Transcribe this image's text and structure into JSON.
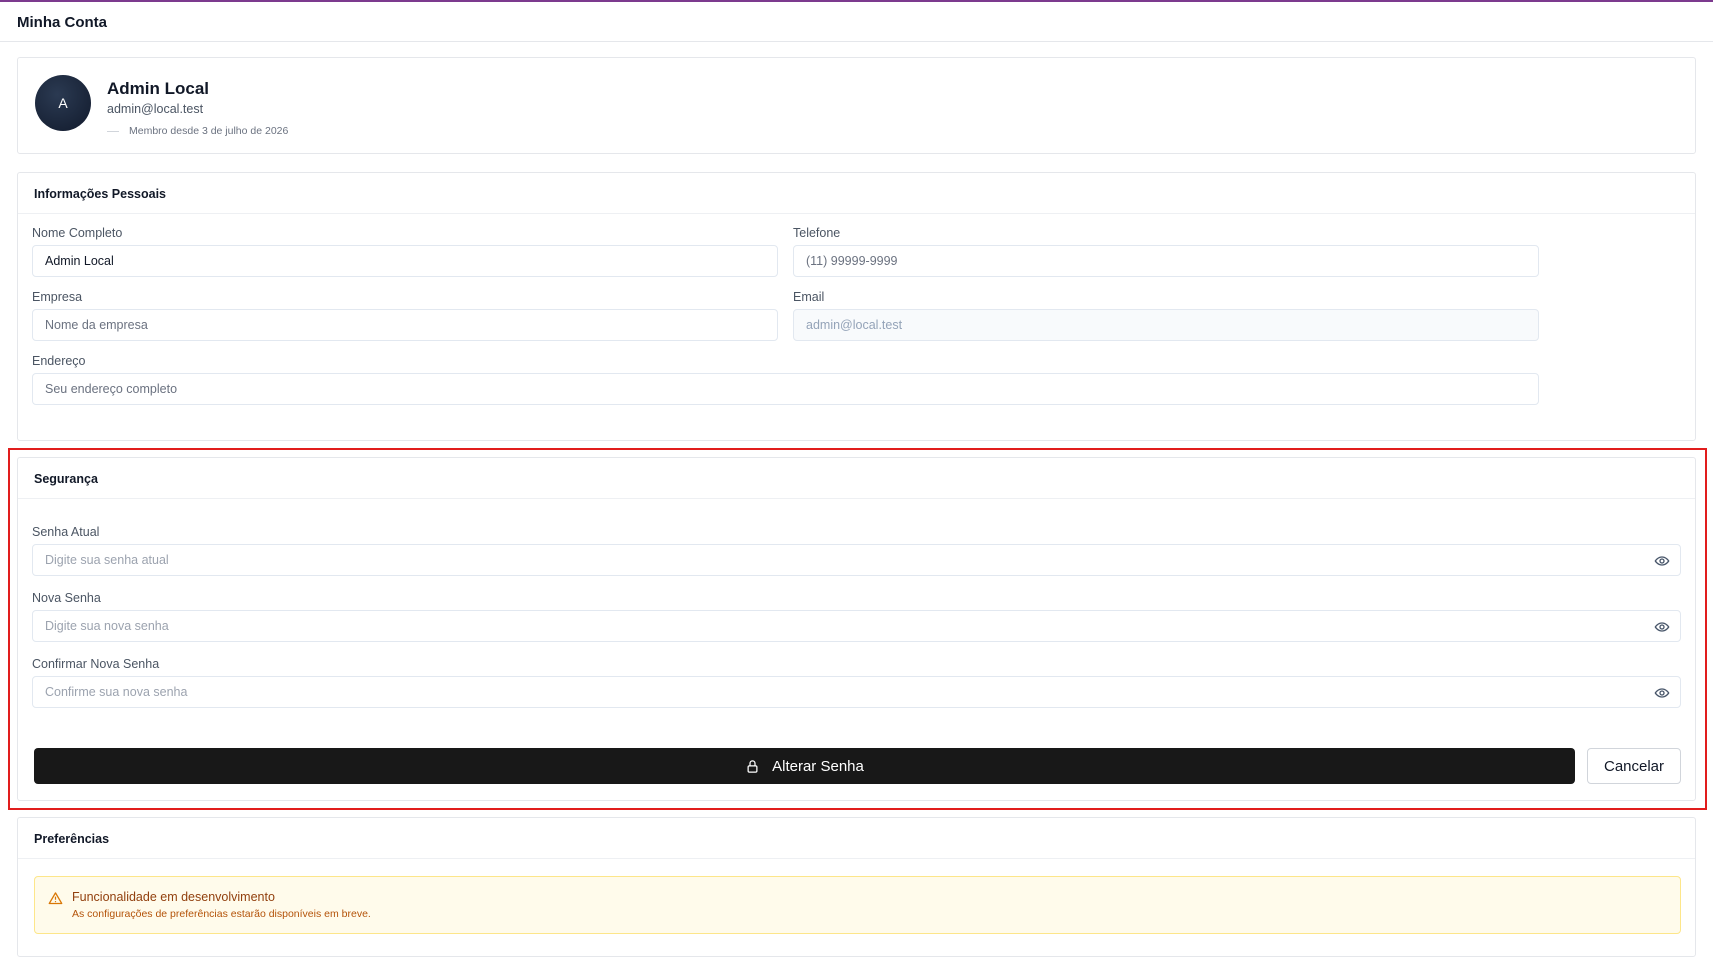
{
  "header": {
    "title": "Minha Conta"
  },
  "profile": {
    "avatar_initial": "A",
    "name": "Admin Local",
    "email": "admin@local.test",
    "member_since": "Membro desde 3 de julho de 2026"
  },
  "personal": {
    "title": "Informações Pessoais",
    "full_name": {
      "label": "Nome Completo",
      "value": "Admin Local"
    },
    "phone": {
      "label": "Telefone",
      "placeholder": "(11) 99999-9999"
    },
    "company": {
      "label": "Empresa",
      "placeholder": "Nome da empresa"
    },
    "email": {
      "label": "Email",
      "value": "admin@local.test"
    },
    "address": {
      "label": "Endereço",
      "placeholder": "Seu endereço completo"
    }
  },
  "security": {
    "title": "Segurança",
    "current": {
      "label": "Senha Atual",
      "placeholder": "Digite sua senha atual"
    },
    "new": {
      "label": "Nova Senha",
      "placeholder": "Digite sua nova senha"
    },
    "confirm": {
      "label": "Confirmar Nova Senha",
      "placeholder": "Confirme sua nova senha"
    },
    "submit_label": "Alterar Senha",
    "cancel_label": "Cancelar"
  },
  "preferences": {
    "title": "Preferências",
    "alert_title": "Funcionalidade em desenvolvimento",
    "alert_text": "As configurações de preferências estarão disponíveis em breve."
  },
  "colors": {
    "accent_line": "#7c3a8e",
    "highlight": "#e11d1d",
    "primary_button": "#181818",
    "alert_bg": "#fffbeb"
  },
  "icons": {
    "password_toggle": "eye-icon",
    "submit": "lock-icon",
    "alert": "warning-triangle-icon"
  }
}
